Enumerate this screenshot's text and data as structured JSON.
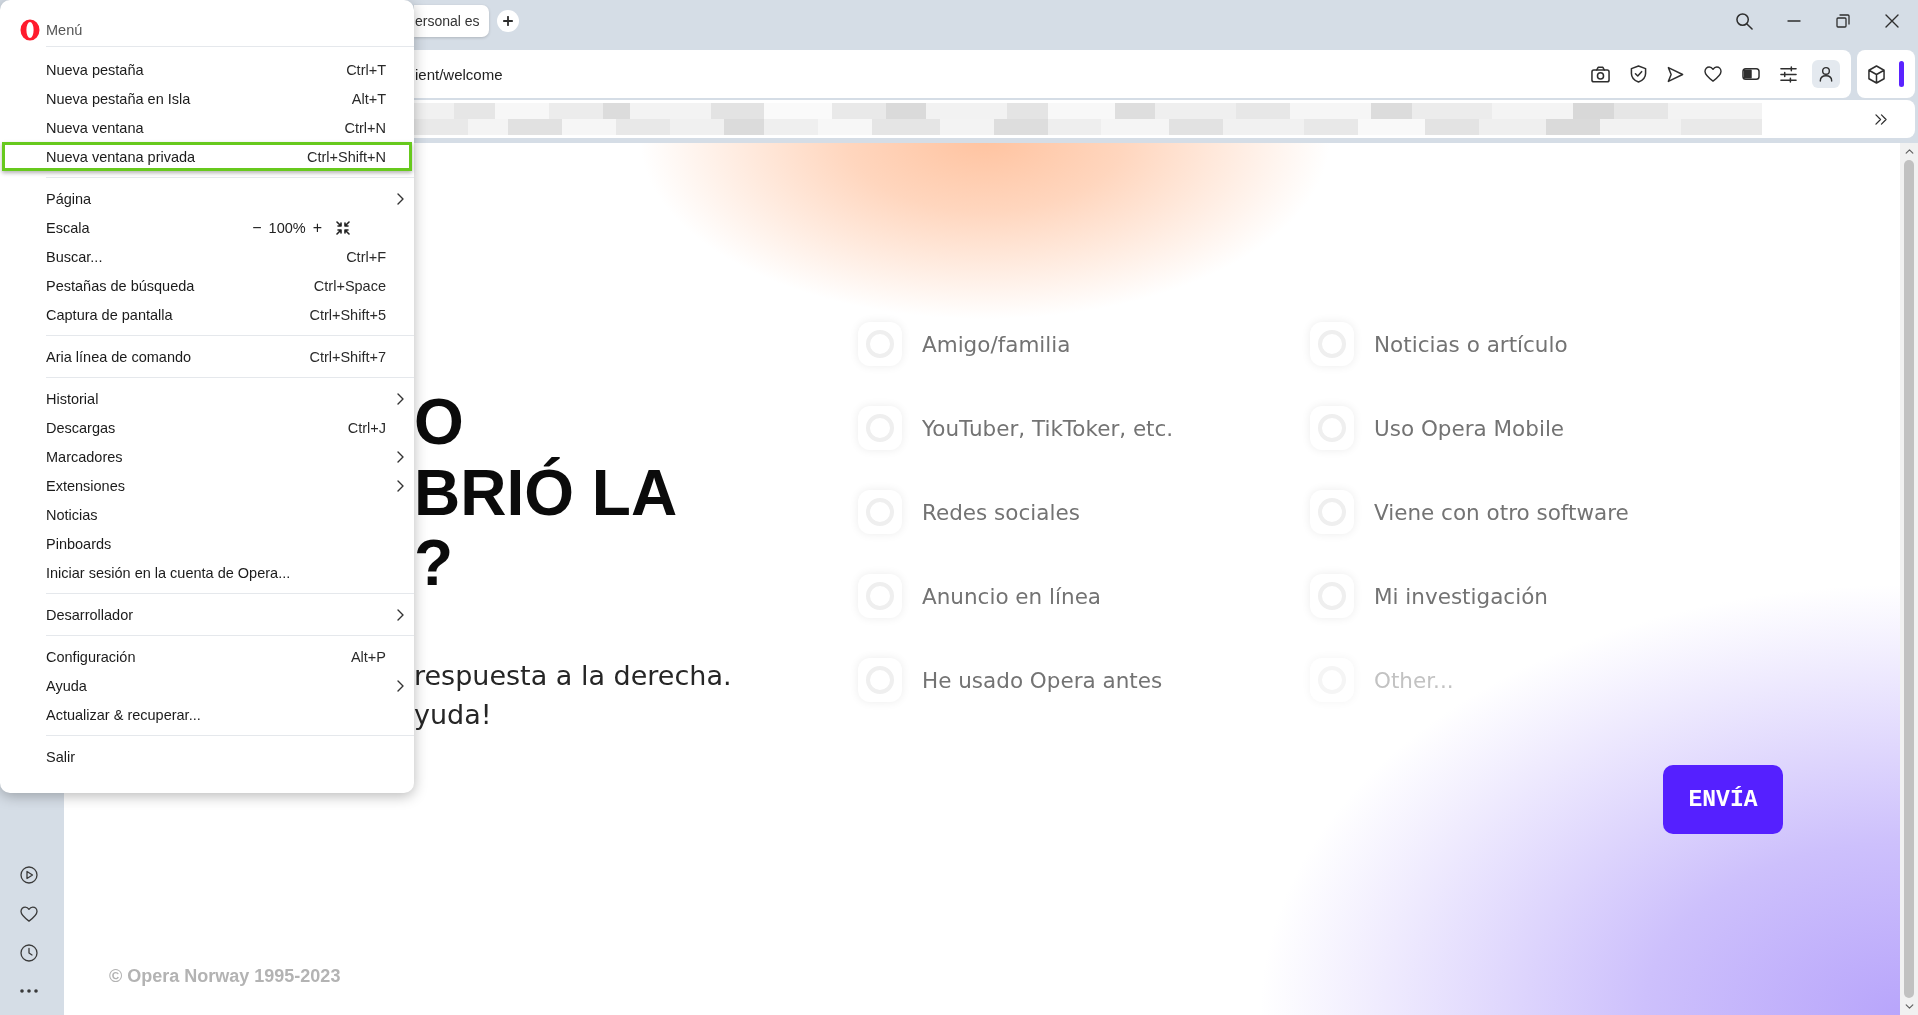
{
  "tab_bar": {
    "tabs": [
      {
        "title": "ersonal es",
        "selected": true
      }
    ]
  },
  "address_bar": {
    "url": "ient/welcome"
  },
  "menu": {
    "title": "Menú",
    "groups": [
      {
        "items": [
          {
            "kind": "command",
            "label": "Nueva pestaña",
            "shortcut": "Ctrl+T",
            "submenu": false,
            "highlighted": false
          },
          {
            "kind": "command",
            "label": "Nueva pestaña en Isla",
            "shortcut": "Alt+T",
            "submenu": false,
            "highlighted": false
          },
          {
            "kind": "command",
            "label": "Nueva ventana",
            "shortcut": "Ctrl+N",
            "submenu": false,
            "highlighted": false
          },
          {
            "kind": "command",
            "label": "Nueva ventana privada",
            "shortcut": "Ctrl+Shift+N",
            "submenu": false,
            "highlighted": true
          }
        ]
      },
      {
        "items": [
          {
            "kind": "command",
            "label": "Página",
            "submenu": true,
            "highlighted": false
          },
          {
            "kind": "zoom",
            "label": "Escala",
            "zoom_out": "−",
            "zoom_level": "100%",
            "zoom_in": "+",
            "submenu": false,
            "highlighted": false
          },
          {
            "kind": "command",
            "label": "Buscar...",
            "shortcut": "Ctrl+F",
            "submenu": false,
            "highlighted": false
          },
          {
            "kind": "command",
            "label": "Pestañas de búsqueda",
            "shortcut": "Ctrl+Space",
            "submenu": false,
            "highlighted": false
          },
          {
            "kind": "command",
            "label": "Captura de pantalla",
            "shortcut": "Ctrl+Shift+5",
            "submenu": false,
            "highlighted": false
          }
        ]
      },
      {
        "items": [
          {
            "kind": "command",
            "label": "Aria línea de comando",
            "shortcut": "Ctrl+Shift+7",
            "submenu": false,
            "highlighted": false
          }
        ]
      },
      {
        "items": [
          {
            "kind": "command",
            "label": "Historial",
            "submenu": true,
            "highlighted": false
          },
          {
            "kind": "command",
            "label": "Descargas",
            "shortcut": "Ctrl+J",
            "submenu": false,
            "highlighted": false
          },
          {
            "kind": "command",
            "label": "Marcadores",
            "submenu": true,
            "highlighted": false
          },
          {
            "kind": "command",
            "label": "Extensiones",
            "submenu": true,
            "highlighted": false
          },
          {
            "kind": "command",
            "label": "Noticias",
            "submenu": false,
            "highlighted": false
          },
          {
            "kind": "command",
            "label": "Pinboards",
            "submenu": false,
            "highlighted": false
          },
          {
            "kind": "command",
            "label": "Iniciar sesión en la cuenta de Opera...",
            "submenu": false,
            "highlighted": false
          }
        ]
      },
      {
        "items": [
          {
            "kind": "command",
            "label": "Desarrollador",
            "submenu": true,
            "highlighted": false
          }
        ]
      },
      {
        "items": [
          {
            "kind": "command",
            "label": "Configuración",
            "shortcut": "Alt+P",
            "submenu": false,
            "highlighted": false
          },
          {
            "kind": "command",
            "label": "Ayuda",
            "submenu": true,
            "highlighted": false
          },
          {
            "kind": "command",
            "label": "Actualizar & recuperar...",
            "submenu": false,
            "highlighted": false
          }
        ]
      },
      {
        "items": [
          {
            "kind": "command",
            "label": "Salir",
            "submenu": false,
            "highlighted": false
          }
        ]
      }
    ]
  },
  "page": {
    "heading_lines": [
      "O",
      "BRIÓ LA",
      "?"
    ],
    "intro_lines": [
      "respuesta a la derecha.",
      "yuda!"
    ],
    "options": [
      {
        "kind": "choice",
        "label": "Amigo/familia",
        "selected": false
      },
      {
        "kind": "choice",
        "label": "Noticias o artículo",
        "selected": false
      },
      {
        "kind": "choice",
        "label": "YouTuber, TikToker, etc.",
        "selected": false
      },
      {
        "kind": "choice",
        "label": "Uso Opera Mobile",
        "selected": false
      },
      {
        "kind": "choice",
        "label": "Redes sociales",
        "selected": false
      },
      {
        "kind": "choice",
        "label": "Viene con otro software",
        "selected": false
      },
      {
        "kind": "choice",
        "label": "Anuncio en línea",
        "selected": false
      },
      {
        "kind": "choice",
        "label": "Mi investigación",
        "selected": false
      },
      {
        "kind": "choice",
        "label": "He usado Opera antes",
        "selected": false
      },
      {
        "kind": "other",
        "placeholder": "Other...",
        "selected": false
      }
    ],
    "submit_button": "ENVÍA",
    "footer": "© Opera Norway 1995-2023"
  }
}
